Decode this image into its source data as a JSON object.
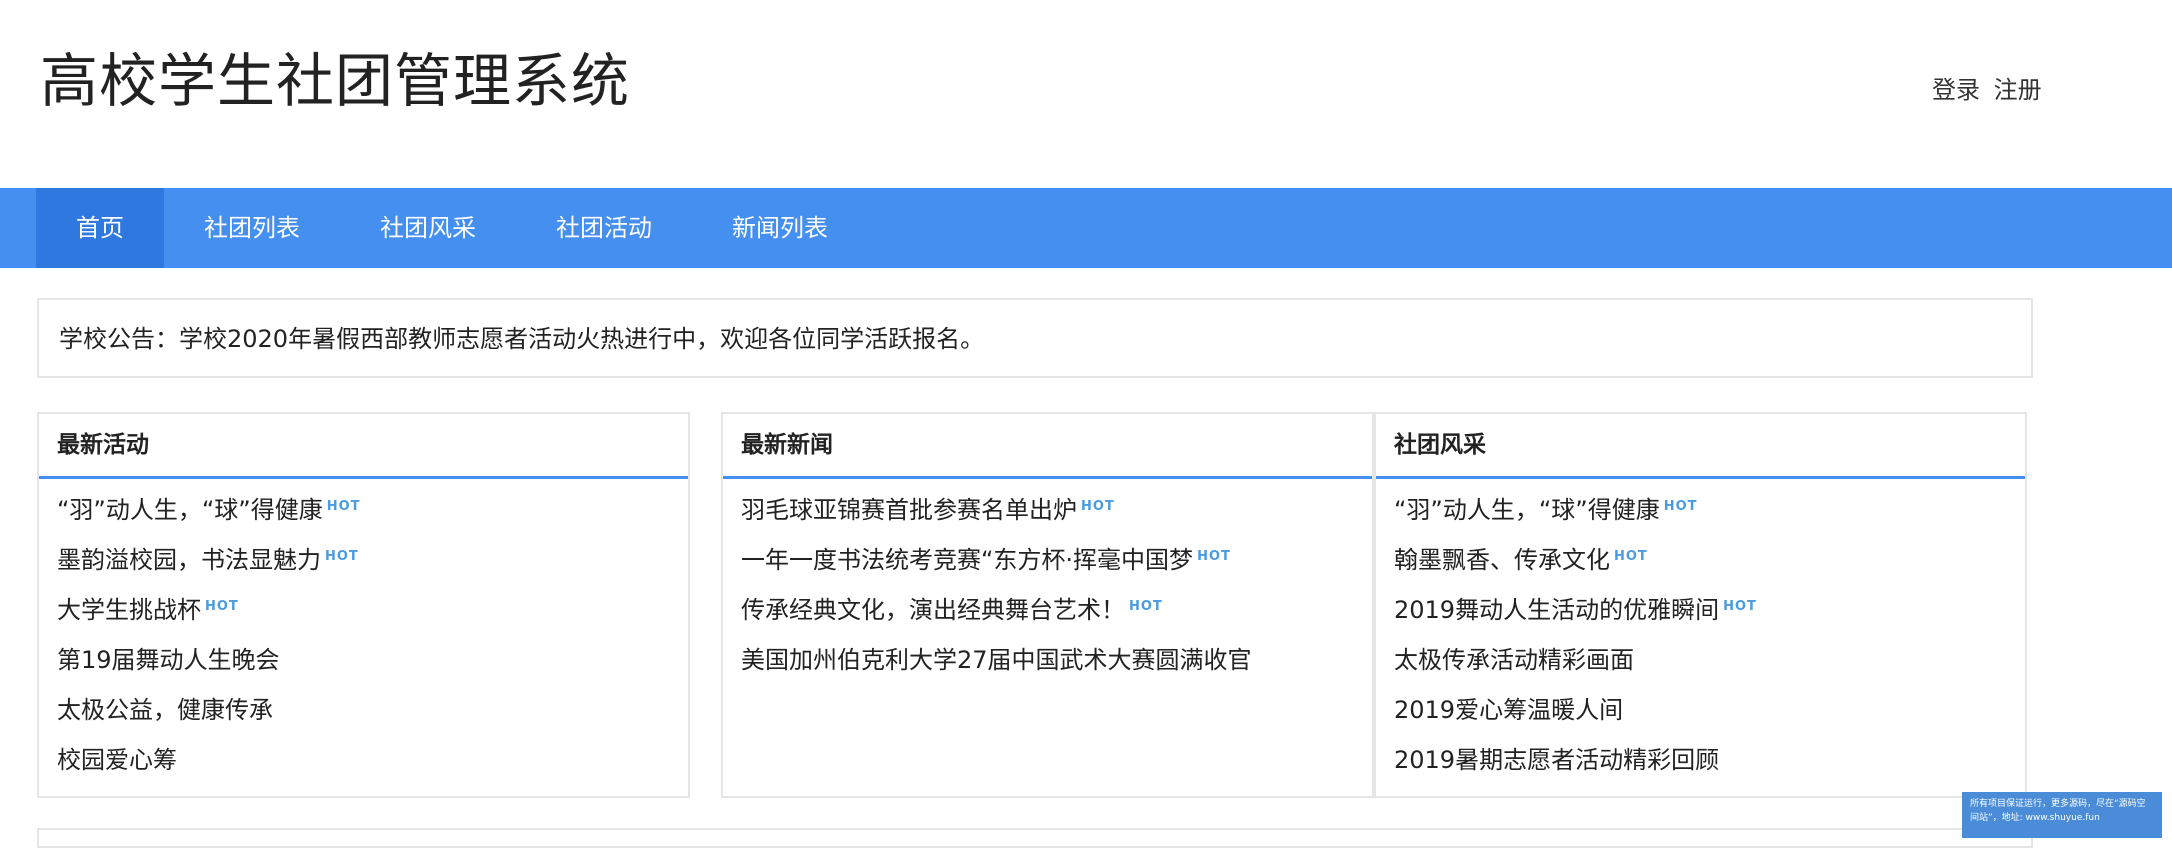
{
  "header": {
    "site_title": "高校学生社团管理系统",
    "login": "登录",
    "register": "注册"
  },
  "nav": {
    "items": [
      {
        "label": "首页",
        "active": true
      },
      {
        "label": "社团列表"
      },
      {
        "label": "社团风采"
      },
      {
        "label": "社团活动"
      },
      {
        "label": "新闻列表"
      }
    ]
  },
  "notice": {
    "text": "学校公告：学校2020年暑假西部教师志愿者活动火热进行中，欢迎各位同学活跃报名。"
  },
  "panels": {
    "activities": {
      "title": "最新活动",
      "items": [
        {
          "text": "“羽”动人生，“球”得健康",
          "hot": "HOT"
        },
        {
          "text": "墨韵溢校园，书法显魅力",
          "hot": "HOT"
        },
        {
          "text": "大学生挑战杯",
          "hot": "HOT"
        },
        {
          "text": "第19届舞动人生晚会"
        },
        {
          "text": "太极公益，健康传承"
        },
        {
          "text": "校园爱心筹"
        }
      ]
    },
    "news": {
      "title": "最新新闻",
      "items": [
        {
          "text": "羽毛球亚锦赛首批参赛名单出炉",
          "hot": "HOT"
        },
        {
          "text": "一年一度书法统考竞赛“东方杯·挥毫中国梦",
          "hot": "HOT"
        },
        {
          "text": "传承经典文化，演出经典舞台艺术！",
          "hot": "HOT"
        },
        {
          "text": "美国加州伯克利大学27届中国武术大赛圆满收官"
        }
      ]
    },
    "style": {
      "title": "社团风采",
      "items": [
        {
          "text": "“羽”动人生，“球”得健康",
          "hot": "HOT"
        },
        {
          "text": "翰墨飘香、传承文化",
          "hot": "HOT"
        },
        {
          "text": "2019舞动人生活动的优雅瞬间",
          "hot": "HOT"
        },
        {
          "text": "太极传承活动精彩画面"
        },
        {
          "text": "2019爱心筹温暖人间"
        },
        {
          "text": "2019暑期志愿者活动精彩回顾"
        }
      ]
    }
  },
  "watermark": {
    "text": "所有项目保证运行，更多源码，尽在“源码空间站”，地址: www.shuyue.fun"
  },
  "colors": {
    "nav_bg": "#448ff0",
    "nav_active": "#2f78df",
    "hot": "#4a9be0"
  }
}
